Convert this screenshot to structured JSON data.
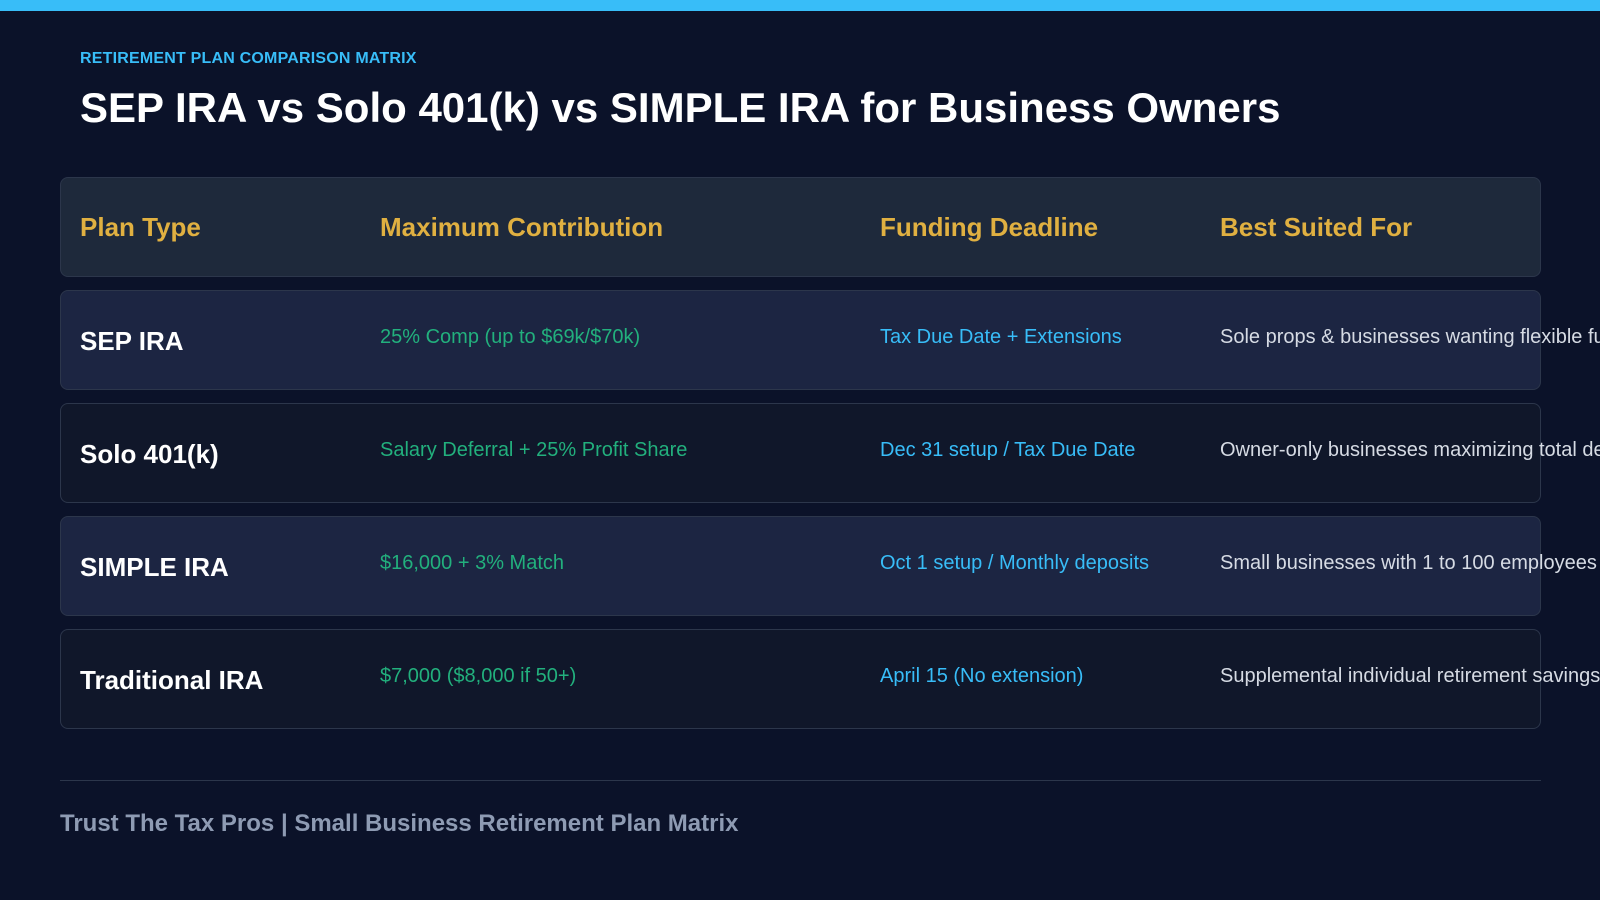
{
  "header": {
    "eyebrow": "RETIREMENT PLAN COMPARISON MATRIX",
    "title": "SEP IRA vs Solo 401(k) vs SIMPLE IRA for Business Owners"
  },
  "table": {
    "columns": [
      "Plan Type",
      "Maximum Contribution",
      "Funding Deadline",
      "Best Suited For"
    ],
    "rows": [
      {
        "plan": "SEP IRA",
        "max_contribution": "25% Comp (up to $69k/$70k)",
        "deadline": "Tax Due Date + Extensions",
        "best_for": "Sole props & businesses wanting flexible fu"
      },
      {
        "plan": "Solo 401(k)",
        "max_contribution": "Salary Deferral + 25% Profit Share",
        "deadline": "Dec 31 setup / Tax Due Date",
        "best_for": "Owner-only businesses maximizing total de"
      },
      {
        "plan": "SIMPLE IRA",
        "max_contribution": "$16,000 + 3% Match",
        "deadline": "Oct 1 setup / Monthly deposits",
        "best_for": "Small businesses with 1 to 100 employees"
      },
      {
        "plan": "Traditional IRA",
        "max_contribution": "$7,000 ($8,000 if 50+)",
        "deadline": "April 15 (No extension)",
        "best_for": "Supplemental individual retirement savings"
      }
    ]
  },
  "footer": {
    "text": "Trust The Tax Pros | Small Business Retirement Plan Matrix"
  },
  "colors": {
    "background": "#0b1229",
    "accent": "#38bdf8",
    "header_text": "#e0b041",
    "contribution_text": "#22b07d"
  }
}
